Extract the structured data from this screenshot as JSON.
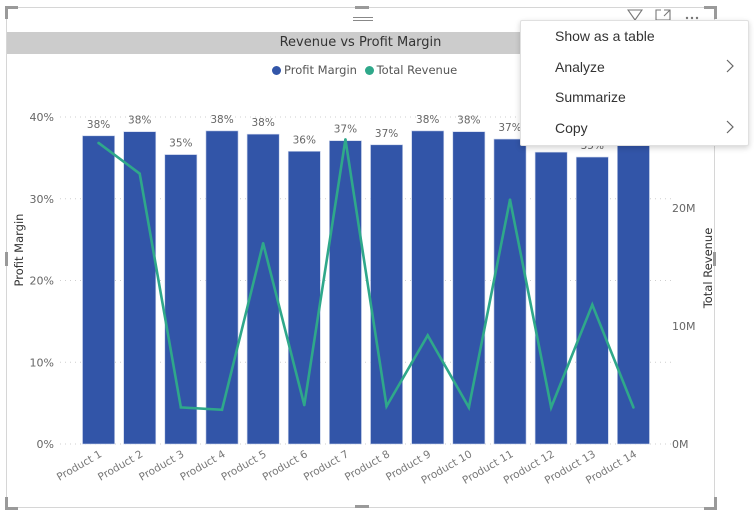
{
  "visual": {
    "title": "Revenue vs Profit Margin",
    "header_icons": [
      "filter-icon",
      "focus-mode-icon",
      "more-options-icon"
    ]
  },
  "context_menu": {
    "items": [
      {
        "label": "Show as a table",
        "has_submenu": false
      },
      {
        "label": "Analyze",
        "has_submenu": true
      },
      {
        "label": "Summarize",
        "has_submenu": false
      },
      {
        "label": "Copy",
        "has_submenu": true
      }
    ],
    "chevron_glyph": ">"
  },
  "colors": {
    "bar": "#3255a8",
    "line": "#2fa88a",
    "title_bar_bg": "#cccccc",
    "gridline": "#cfcfcf",
    "label_text": "#666666"
  },
  "chart_data": {
    "type": "bar+line",
    "title": "Revenue vs Profit Margin",
    "legend": {
      "position": "top-center",
      "entries": [
        {
          "name": "Profit Margin",
          "color": "#3255a8"
        },
        {
          "name": "Total Revenue",
          "color": "#2fa88a"
        }
      ]
    },
    "categories": [
      "Product 1",
      "Product 2",
      "Product 3",
      "Product 4",
      "Product 5",
      "Product 6",
      "Product 7",
      "Product 8",
      "Product 9",
      "Product 10",
      "Product 11",
      "Product 12",
      "Product 13",
      "Product 14"
    ],
    "series": [
      {
        "name": "Profit Margin",
        "type": "bar",
        "axis": "left",
        "values": [
          37.7,
          38.2,
          35.4,
          38.3,
          37.9,
          35.8,
          37.1,
          36.6,
          38.3,
          38.2,
          37.3,
          35.7,
          35.1,
          36.6
        ],
        "data_labels": [
          "38%",
          "38%",
          "35%",
          "38%",
          "38%",
          "36%",
          "37%",
          "37%",
          "38%",
          "38%",
          "37%",
          "36%",
          "35%",
          "37%"
        ]
      },
      {
        "name": "Total Revenue",
        "type": "line",
        "axis": "right",
        "values": [
          25.5,
          22.9,
          3.1,
          2.9,
          17.0,
          3.3,
          25.8,
          3.2,
          9.2,
          3.1,
          20.7,
          3.1,
          11.8,
          3.1
        ],
        "unit": "M"
      }
    ],
    "y_left": {
      "label": "Profit Margin",
      "range": [
        0,
        40
      ],
      "ticks": [
        0,
        10,
        20,
        30,
        40
      ],
      "tick_labels": [
        "0%",
        "10%",
        "20%",
        "30%",
        "40%"
      ]
    },
    "y_right": {
      "label": "Total Revenue",
      "range": [
        0,
        27.7
      ],
      "ticks": [
        0,
        10,
        20
      ],
      "tick_labels": [
        "0M",
        "10M",
        "20M"
      ]
    },
    "xlabel": "",
    "grid": true
  }
}
